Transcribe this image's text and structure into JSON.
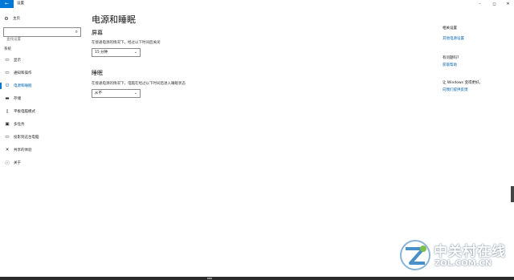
{
  "window": {
    "title": "设置",
    "back_icon": "←",
    "min_icon": "–",
    "max_icon": "◻",
    "close_icon": "✕"
  },
  "sidebar": {
    "home_label": "主页",
    "search_placeholder": "查找设置",
    "section_label": "系统",
    "items": [
      {
        "label": "显示",
        "icon": "▭"
      },
      {
        "label": "通知和操作",
        "icon": "▭"
      },
      {
        "label": "电源和睡眠",
        "icon": "⏻"
      },
      {
        "label": "存储",
        "icon": "▬"
      },
      {
        "label": "平板电脑模式",
        "icon": "▯"
      },
      {
        "label": "多任务",
        "icon": "▣"
      },
      {
        "label": "投影到这台电脑",
        "icon": "▭"
      },
      {
        "label": "共享的体验",
        "icon": "✕"
      },
      {
        "label": "关于",
        "icon": "ⓘ"
      }
    ],
    "active_index": 2
  },
  "main": {
    "title": "电源和睡眠",
    "screen": {
      "heading": "屏幕",
      "description": "在接通电源的情况下，经过以下时间后关闭",
      "value": "15 分钟"
    },
    "sleep": {
      "heading": "睡眠",
      "description": "在接通电源的情况下，电脑在经过以下时间后进入睡眠状态",
      "value": "从不"
    }
  },
  "related": {
    "heading": "相关设置",
    "link": "其他电源设置",
    "question_heading": "有问题吗?",
    "help_link": "获取帮助",
    "feedback_heading": "让 Windows 变得更好。",
    "feedback_link": "向我们提供反馈"
  },
  "watermark": {
    "cn": "中关村在线",
    "en": "ZOL.COM.CN"
  },
  "colors": {
    "accent": "#0078d7",
    "link": "#0063b1"
  }
}
